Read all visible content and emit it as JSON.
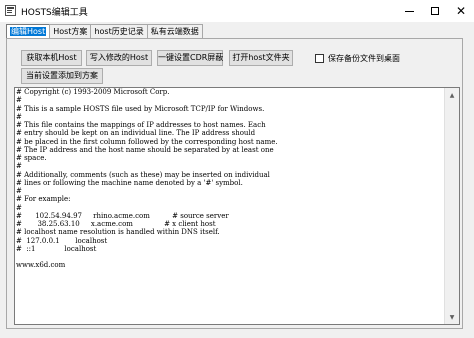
{
  "window": {
    "title": "HOSTS编辑工具",
    "minimize_glyph": "",
    "close_glyph": "✕"
  },
  "tabs": [
    {
      "label": "编辑Host",
      "active": true
    },
    {
      "label": "Host方案",
      "active": false
    },
    {
      "label": "host历史记录",
      "active": false
    },
    {
      "label": "私有云端数据",
      "active": false
    }
  ],
  "toolbar": {
    "get_local_host": "获取本机Host",
    "write_modified_host": "写入修改的Host",
    "set_cdn_shield": "一键设置CDR屏蔽",
    "open_host_folder": "打开host文件夹",
    "add_to_scheme": "当前设置添加到方案"
  },
  "backup_option": {
    "label": "保存备份文件到桌面",
    "checked": false
  },
  "editor": {
    "content": "# Copyright (c) 1993-2009 Microsoft Corp.\n#\n# This is a sample HOSTS file used by Microsoft TCP/IP for Windows.\n#\n# This file contains the mappings of IP addresses to host names. Each\n# entry should be kept on an individual line. The IP address should\n# be placed in the first column followed by the corresponding host name.\n# The IP address and the host name should be separated by at least one\n# space.\n#\n# Additionally, comments (such as these) may be inserted on individual\n# lines or following the machine name denoted by a '#' symbol.\n#\n# For example:\n#\n#      102.54.94.97     rhino.acme.com          # source server\n#       38.25.63.10     x.acme.com              # x client host\n# localhost name resolution is handled within DNS itself.\n#  127.0.0.1       localhost\n#  ::1             localhost\n\nwww.x6d.com"
  },
  "scrollbar": {
    "up_icon": "▲",
    "down_icon": "▼"
  }
}
